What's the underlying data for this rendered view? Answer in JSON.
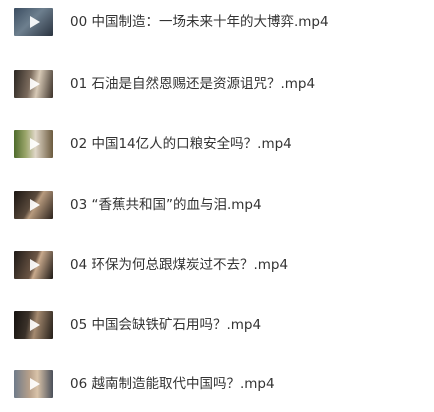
{
  "files": [
    {
      "name": "00 中国制造：一场未来十年的大博弈.mp4",
      "thumbnail_icon": "video-thumbnail"
    },
    {
      "name": "01 石油是自然恩赐还是资源诅咒？.mp4",
      "thumbnail_icon": "video-thumbnail"
    },
    {
      "name": "02 中国14亿人的口粮安全吗？.mp4",
      "thumbnail_icon": "video-thumbnail"
    },
    {
      "name": "03 “香蕉共和国”的血与泪.mp4",
      "thumbnail_icon": "video-thumbnail"
    },
    {
      "name": "04 环保为何总跟煤炭过不去？.mp4",
      "thumbnail_icon": "video-thumbnail"
    },
    {
      "name": "05 中国会缺铁矿石用吗？.mp4",
      "thumbnail_icon": "video-thumbnail"
    },
    {
      "name": "06 越南制造能取代中国吗？.mp4",
      "thumbnail_icon": "video-thumbnail"
    }
  ],
  "colors": {
    "text": "#333333",
    "background": "#ffffff",
    "play_icon": "#ffffff"
  }
}
